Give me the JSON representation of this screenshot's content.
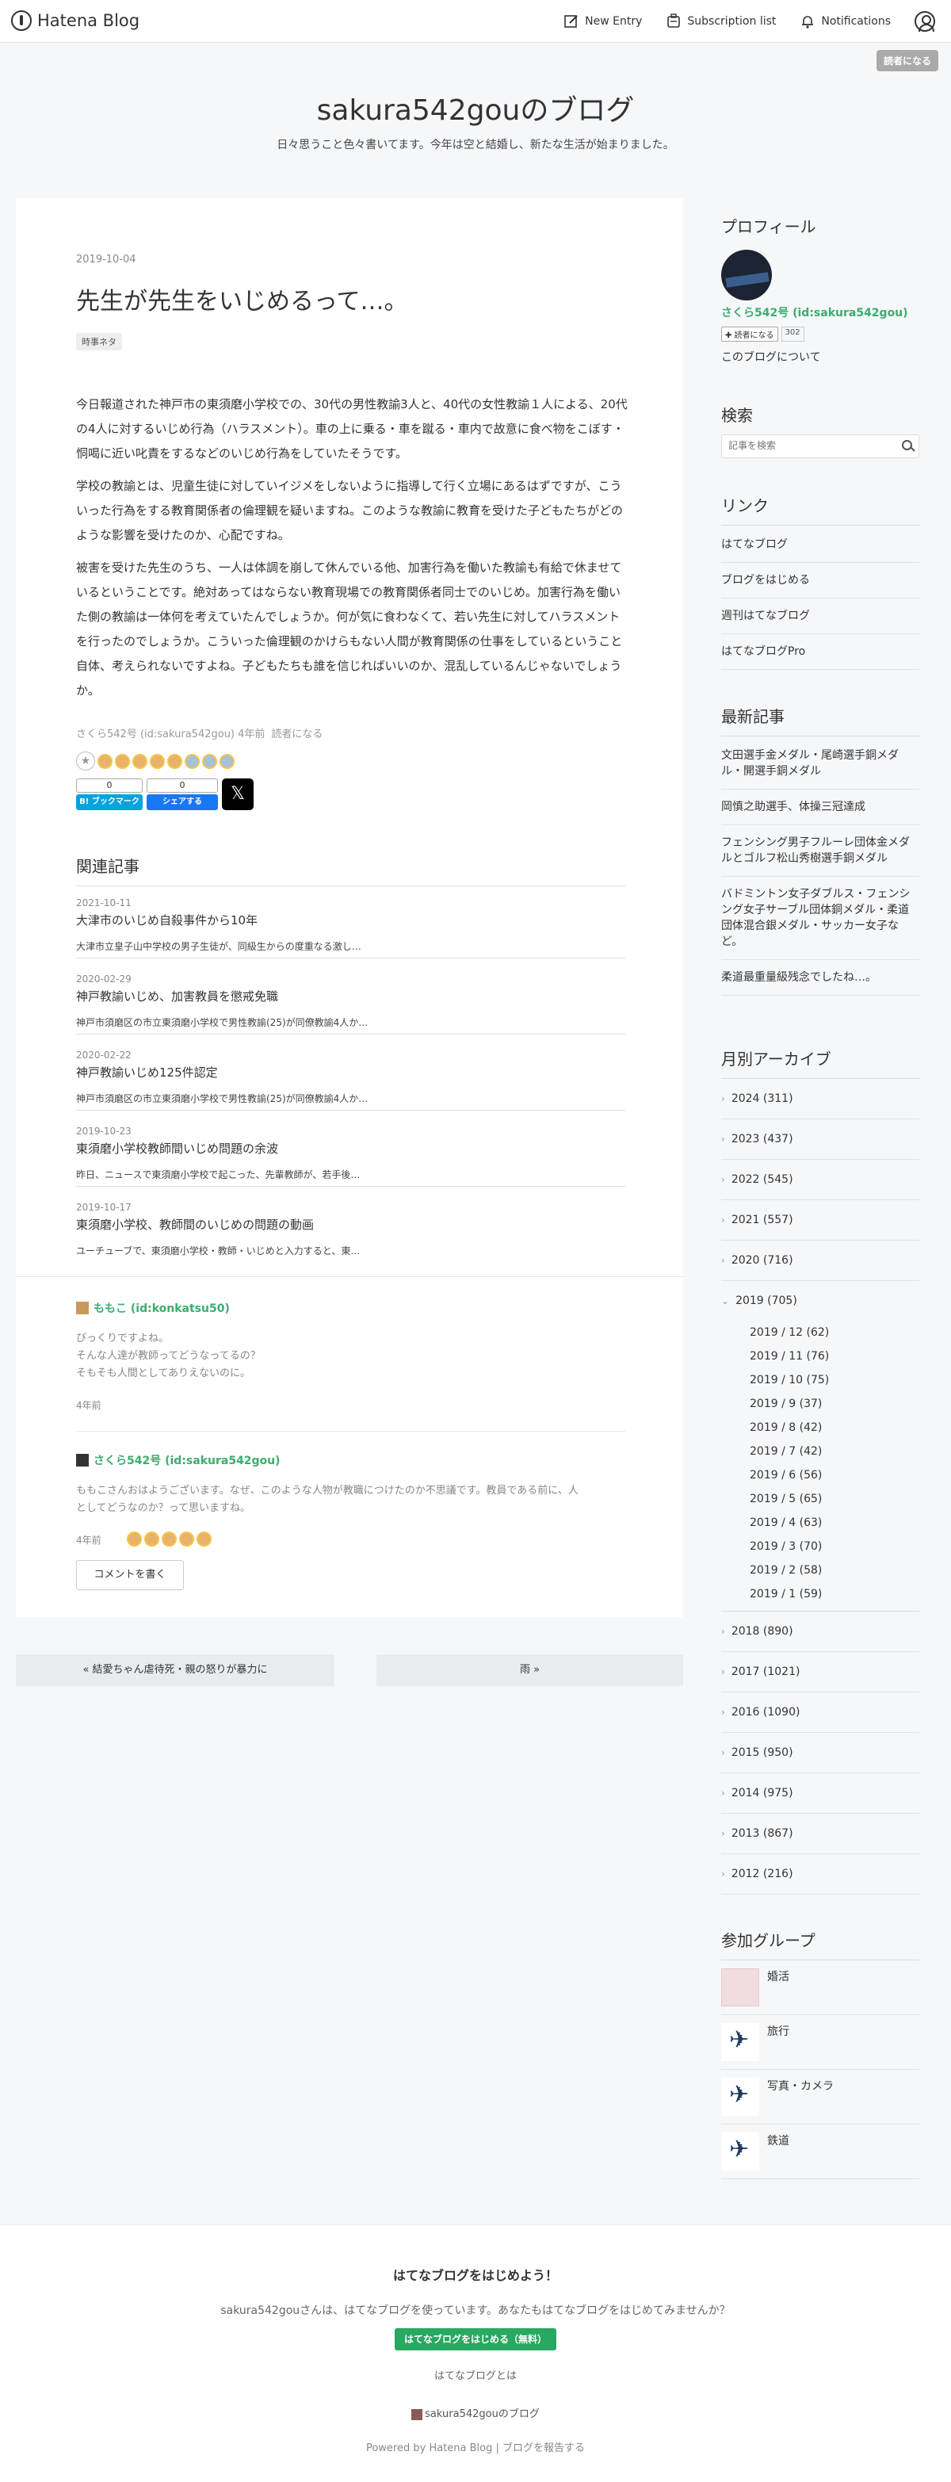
{
  "header": {
    "logo_text": "Hatena Blog",
    "new_entry": "New Entry",
    "subscription_list": "Subscription list",
    "notifications": "Notifications",
    "subscribe_button": "読者になる"
  },
  "blog": {
    "title": "sakura542gouのブログ",
    "description": "日々思うこと色々書いてます。今年は空と結婚し、新たな生活が始まりました。"
  },
  "article": {
    "date": "2019-10-04",
    "title": "先生が先生をいじめるって…。",
    "category": "時事ネタ",
    "paragraphs": [
      "今日報道された神戸市の東須磨小学校での、30代の男性教諭3人と、40代の女性教諭１人による、20代の4人に対するいじめ行為（ハラスメント）。車の上に乗る・車を蹴る・車内で故意に食べ物をこぼす・恫喝に近い叱責をするなどのいじめ行為をしていたそうです。",
      "学校の教諭とは、児童生徒に対していイジメをしないように指導して行く立場にあるはずですが、こういった行為をする教育関係者の倫理観を疑いますね。このような教諭に教育を受けた子どもたちがどのような影響を受けたのか、心配ですね。",
      "被害を受けた先生のうち、一人は体調を崩して休んでいる他、加害行為を働いた教諭も有給で休ませているということです。絶対あってはならない教育現場での教育関係者同士でのいじめ。加害行為を働いた側の教諭は一体何を考えていたんでしょうか。何が気に食わなくて、若い先生に対してハラスメントを行ったのでしょうか。こういった倫理観のかけらもない人間が教育関係の仕事をしているということ自体、考えられないですよね。子どもたちも誰を信じればいいのか、混乱しているんじゃないでしょうか。"
    ],
    "author_line": "さくら542号 (id:sakura542gou) 4年前",
    "subscribe_link": "読者になる",
    "bookmark_count": "0",
    "bookmark_label": "B! ブックマーク",
    "share_count": "0",
    "share_label": "シェアする",
    "x_label": "𝕏"
  },
  "related": {
    "heading": "関連記事",
    "items": [
      {
        "date": "2021-10-11",
        "title": "大津市のいじめ自殺事件から10年",
        "snippet": "大津市立皇子山中学校の男子生徒が、同級生からの度重なる激し…"
      },
      {
        "date": "2020-02-29",
        "title": "神戸教諭いじめ、加害教員を懲戒免職",
        "snippet": "神戸市須磨区の市立東須磨小学校で男性教諭(25)が同僚教諭4人か…"
      },
      {
        "date": "2020-02-22",
        "title": "神戸教諭いじめ125件認定",
        "snippet": "神戸市須磨区の市立東須磨小学校で男性教諭(25)が同僚教諭4人か…"
      },
      {
        "date": "2019-10-23",
        "title": "東須磨小学校教師間いじめ問題の余波",
        "snippet": "昨日、ニュースで東須磨小学校で起こった、先輩教師が、若手後…"
      },
      {
        "date": "2019-10-17",
        "title": "東須磨小学校、教師間のいじめの問題の動画",
        "snippet": "ユーチューブで、東須磨小学校・教師・いじめと入力すると、東…"
      }
    ]
  },
  "comments": [
    {
      "author": "ももこ (id:konkatsu50)",
      "text": [
        "びっくりですよね。",
        "そんな人達が教師ってどうなってるの？",
        "そもそも人間としてありえないのに。"
      ],
      "when": "4年前"
    },
    {
      "author": "さくら542号 (id:sakura542gou)",
      "text": [
        "ももこさんおはようございます。なぜ、このような人物が教職につけたのか不思議です。教員である前に、人",
        "としてどうなのか？って思いますね。"
      ],
      "when": "4年前"
    }
  ],
  "comment_button": "コメントを書く",
  "pager": {
    "prev": "« 結愛ちゃん虐待死・親の怒りが暴力に",
    "next": "雨 »"
  },
  "sidebar": {
    "profile": {
      "heading": "プロフィール",
      "name": "さくら542号 (id:sakura542gou)",
      "subscribe": "✚ 読者になる",
      "count": "302",
      "about": "このブログについて"
    },
    "search": {
      "heading": "検索",
      "placeholder": "記事を検索"
    },
    "links": {
      "heading": "リンク",
      "items": [
        "はてなブログ",
        "ブログをはじめる",
        "週刊はてなブログ",
        "はてなブログPro"
      ]
    },
    "recent": {
      "heading": "最新記事",
      "items": [
        "文田選手金メダル・尾崎選手銅メダル・開選手銅メダル",
        "岡慎之助選手、体操三冠達成",
        "フェンシング男子フルーレ団体金メダルとゴルフ松山秀樹選手銅メダル",
        "バドミントン女子ダブルス・フェンシング女子サーブル団体銅メダル・柔道団体混合銀メダル・サッカー女子など。",
        "柔道最重量級残念でしたね…。"
      ]
    },
    "archive": {
      "heading": "月別アーカイブ",
      "years_before": [
        "2024 (311)",
        "2023 (437)",
        "2022 (545)",
        "2021 (557)",
        "2020 (716)"
      ],
      "open_year": "2019 (705)",
      "months": [
        "2019 / 12 (62)",
        "2019 / 11 (76)",
        "2019 / 10 (75)",
        "2019 / 9 (37)",
        "2019 / 8 (42)",
        "2019 / 7 (42)",
        "2019 / 6 (56)",
        "2019 / 5 (65)",
        "2019 / 4 (63)",
        "2019 / 3 (70)",
        "2019 / 2 (58)",
        "2019 / 1 (59)"
      ],
      "years_after": [
        "2018 (890)",
        "2017 (1021)",
        "2016 (1090)",
        "2015 (950)",
        "2014 (975)",
        "2013 (867)",
        "2012 (216)"
      ]
    },
    "groups": {
      "heading": "参加グループ",
      "items": [
        "婚活",
        "旅行",
        "写真・カメラ",
        "鉄道"
      ]
    }
  },
  "footer": {
    "title": "はてなブログをはじめよう！",
    "desc": "sakura542gouさんは、はてなブログを使っています。あなたもはてなブログをはじめてみませんか？",
    "button": "はてなブログをはじめる（無料）",
    "about": "はてなブログとは",
    "blog_link": "sakura542gouのブログ",
    "powered": "Powered by Hatena Blog | ブログを報告する"
  }
}
